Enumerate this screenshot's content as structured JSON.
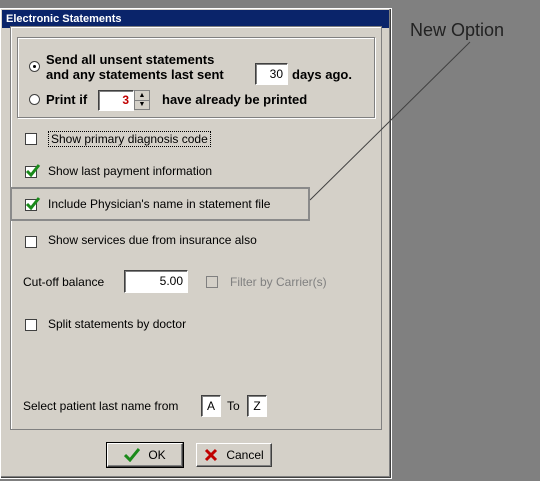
{
  "dialog": {
    "title": "Electronic Statements"
  },
  "send_group": {
    "send_all_line1": "Send all unsent statements",
    "send_all_line2": "and any statements last sent",
    "days_value": "30",
    "days_suffix": "days ago.",
    "print_if_label": "Print if",
    "print_count": "3",
    "print_suffix": "have already be printed",
    "selected": "send_all"
  },
  "options": {
    "show_diagnosis": {
      "label": "Show primary diagnosis code",
      "checked": false
    },
    "show_last_payment": {
      "label": "Show last payment information",
      "checked": true
    },
    "include_physician": {
      "label": "Include Physician's name in statement file",
      "checked": true
    },
    "show_services": {
      "label": "Show services due from insurance also",
      "checked": false
    },
    "split_by_doctor": {
      "label": "Split statements by doctor",
      "checked": false
    }
  },
  "cutoff": {
    "label": "Cut-off balance",
    "value": "5.00",
    "filter_label": "Filter by Carrier(s)"
  },
  "name_range": {
    "label": "Select patient last name from",
    "from": "A",
    "to_label": "To",
    "to": "Z"
  },
  "buttons": {
    "ok": "OK",
    "cancel": "Cancel"
  },
  "annotation": {
    "text": "New Option"
  },
  "colors": {
    "title_bar": "#0a246a",
    "dialog_bg": "#d4d0c8",
    "check_green": "#1a8a1a",
    "cancel_red": "#c00000",
    "spin_value": "#c00000"
  }
}
